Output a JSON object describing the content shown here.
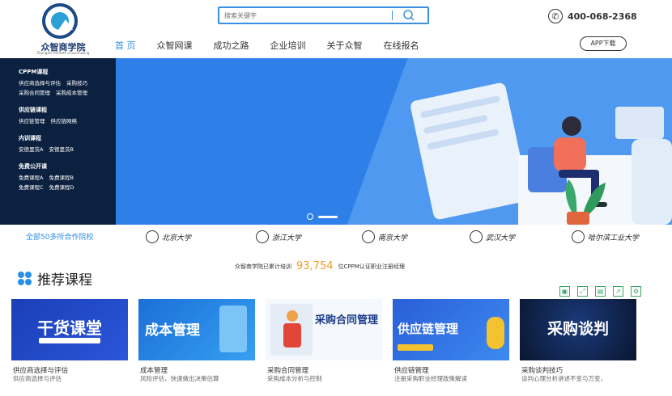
{
  "logo": {
    "name": "众智商学院",
    "sub": "Zhongzhi Institute of purchasing"
  },
  "search": {
    "placeholder": "搜索关键字"
  },
  "phone": {
    "number": "400-068-2368"
  },
  "nav": {
    "items": [
      "首 页",
      "众智网课",
      "成功之路",
      "企业培训",
      "关于众智",
      "在线报名"
    ],
    "app_label": "APP下载"
  },
  "menu": {
    "groups": [
      {
        "title": "CPPM课程",
        "rows": [
          [
            "供应商选择与评估",
            "采购技巧"
          ],
          [
            "采购合同管理",
            "采购成本管理"
          ]
        ]
      },
      {
        "title": "供应链课程",
        "rows": [
          [
            "供应链管理",
            "供应链网络"
          ]
        ]
      },
      {
        "title": "内训课程",
        "rows": [
          [
            "安德里茨A",
            "安德里茨B"
          ]
        ]
      },
      {
        "title": "免费公开课",
        "rows": [
          [
            "免费课程A",
            "免费课程B"
          ],
          [
            "免费课程C",
            "免费课程D"
          ]
        ]
      }
    ]
  },
  "partners": {
    "label": "全部50多所合作院校",
    "universities": [
      "北京大学",
      "浙江大学",
      "南京大学",
      "武汉大学",
      "哈尔滨工业大学"
    ]
  },
  "stats": {
    "prefix": "众智商学院已累计培训",
    "number": "93,754",
    "suffix": "位CPPM认证职业注册经理"
  },
  "section": {
    "title": "推荐课程"
  },
  "cards": [
    {
      "image_text": "干货课堂",
      "title": "供应商选择与评估",
      "desc": "供应商选择与评估",
      "color": "#1b3fb8"
    },
    {
      "image_text": "成本管理",
      "title": "成本管理",
      "desc": "风险评估，快速做出决策估算",
      "color": "#1f7fe0"
    },
    {
      "image_text": "采购合同管理",
      "title": "采购合同管理",
      "desc": "采购成本分析与控制",
      "color": "#ffffff"
    },
    {
      "image_text": "供应链管理",
      "title": "供应链管理",
      "desc": "注册采购职业经理政策解读",
      "color": "#2a6fe0"
    },
    {
      "image_text": "采购谈判",
      "title": "采购谈判技巧",
      "desc": "谈判心理分析讲述不变与万变，",
      "color": "#0d1f44"
    }
  ],
  "colors": {
    "accent": "#2a8fe6",
    "banner": "#2e7fe8",
    "panel": "#0c2140",
    "stat_number": "#f39b20"
  }
}
